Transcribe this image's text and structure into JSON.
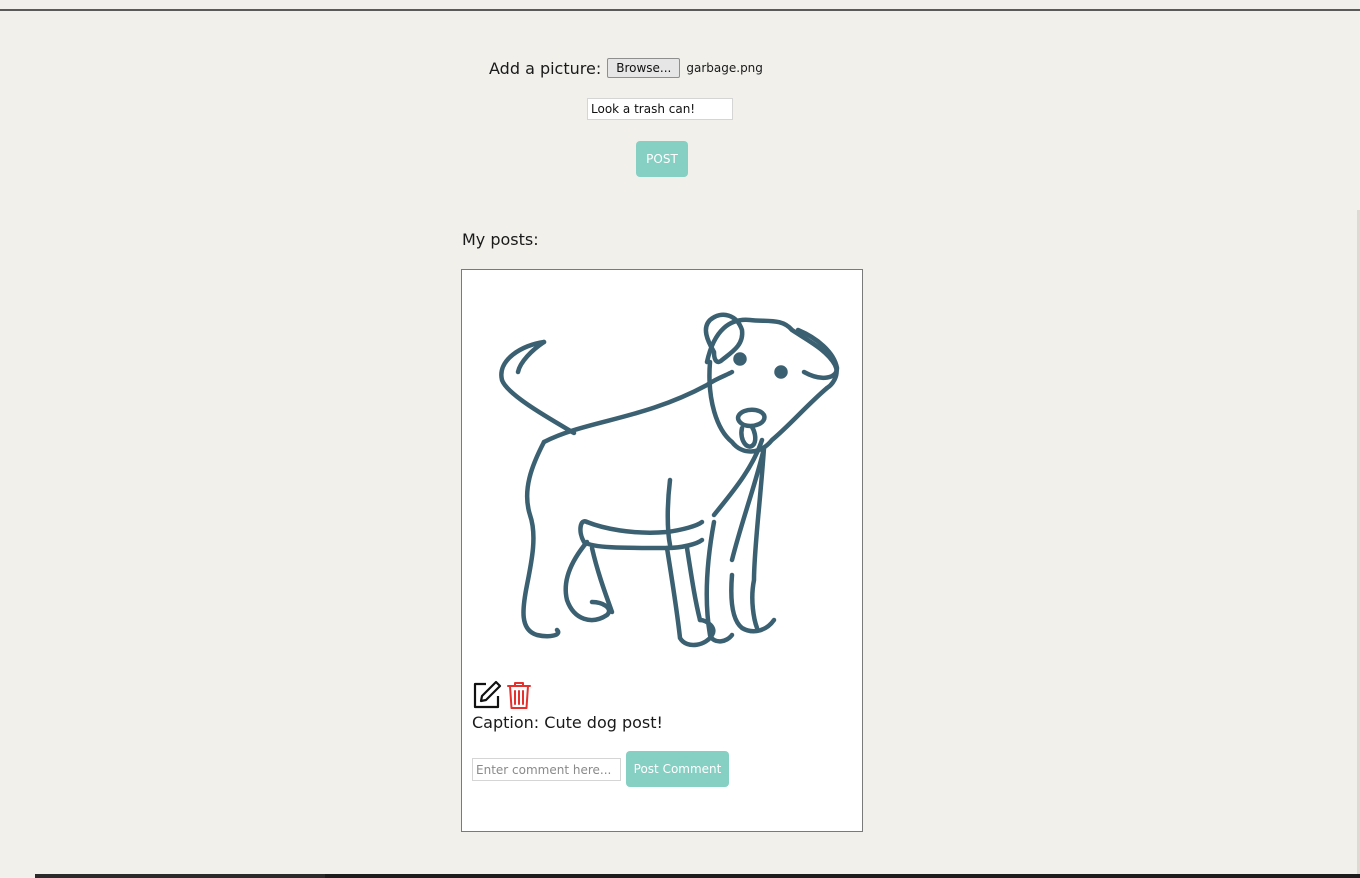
{
  "upload": {
    "label": "Add a picture:",
    "browse_label": "Browse...",
    "file_name": "garbage.png"
  },
  "caption_input": {
    "value": "Look a trash can!"
  },
  "post_button_label": "POST",
  "posts_heading": "My posts:",
  "post": {
    "caption_label": "Caption:",
    "caption_text": "Cute dog post!",
    "comment_placeholder": "Enter comment here...",
    "comment_button_label": "Post Comment",
    "icons": [
      "edit-icon",
      "trash-icon"
    ]
  },
  "colors": {
    "background": "#f1f0eb",
    "accent_button": "#86cfc3",
    "dog_stroke": "#3a6071",
    "delete_icon": "#e5312e"
  }
}
